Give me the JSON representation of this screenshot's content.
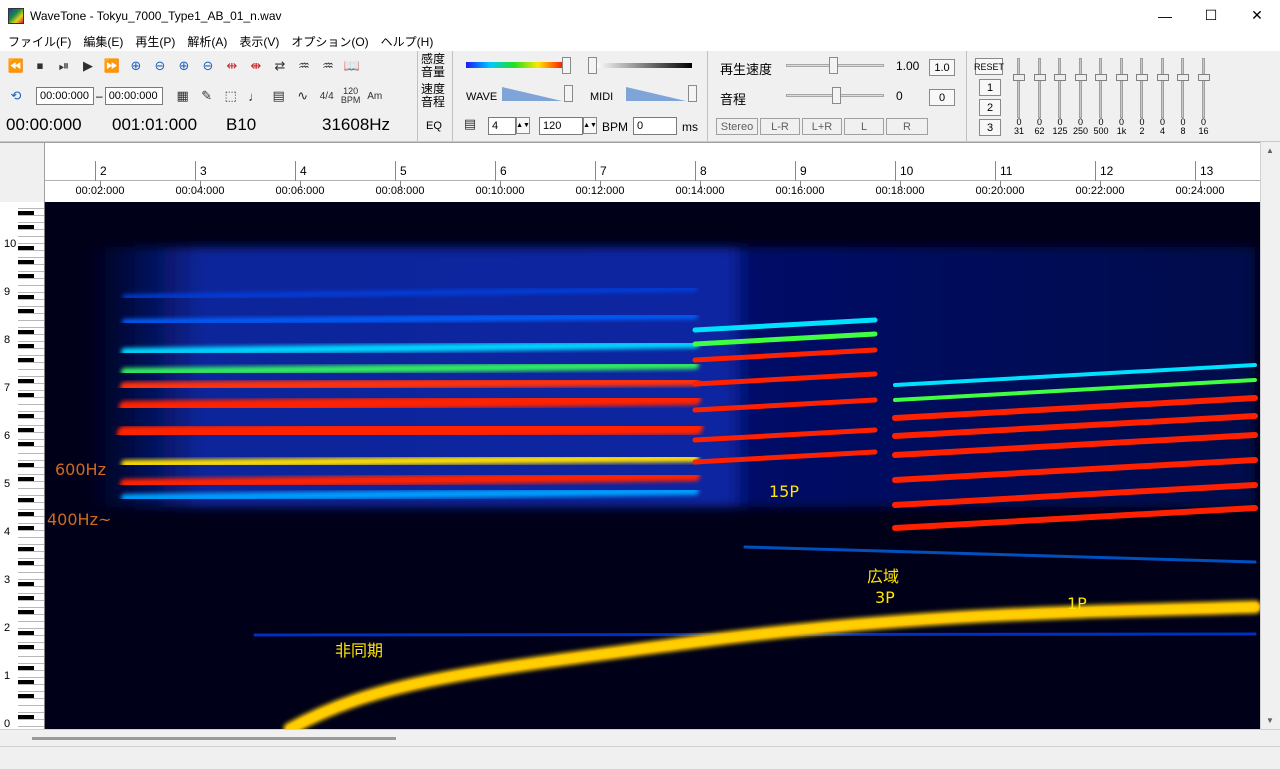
{
  "window": {
    "title": "WaveTone - Tokyu_7000_Type1_AB_01_n.wav",
    "minimize": "—",
    "maximize": "☐",
    "close": "✕"
  },
  "menu": [
    "ファイル(F)",
    "編集(E)",
    "再生(P)",
    "解析(A)",
    "表示(V)",
    "オプション(O)",
    "ヘルプ(H)"
  ],
  "transport": {
    "range_start": "00:00:000",
    "range_sep": "–",
    "range_end": "00:00:000",
    "meter": "4/4",
    "bpm_num": "120",
    "bpm_label": "BPM",
    "chord_label": "Am"
  },
  "status": {
    "position": "00:00:000",
    "measure": "001:01:000",
    "note": "B10",
    "frequency": "31608Hz"
  },
  "panel": {
    "sensitivity_label1": "感度",
    "sensitivity_label2": "音量",
    "speed_label1": "速度",
    "speed_label2": "音程",
    "wave_label": "WAVE",
    "midi_label": "MIDI",
    "eq_label": "EQ",
    "beat_value": "4",
    "bpm_value": "120",
    "bpm_unit": "BPM",
    "ms_value": "0",
    "ms_unit": "ms",
    "playback_speed_label": "再生速度",
    "playback_speed_value": "1.00",
    "playback_speed_reset": "1.0",
    "pitch_label": "音程",
    "pitch_value": "0",
    "pitch_reset": "0",
    "stereo_label": "Stereo",
    "channels": [
      "L-R",
      "L+R",
      "L",
      "R"
    ]
  },
  "equalizer": {
    "reset": "RESET",
    "presets": [
      "1",
      "2",
      "3"
    ],
    "bands": [
      {
        "value": "0",
        "freq": "31"
      },
      {
        "value": "0",
        "freq": "62"
      },
      {
        "value": "0",
        "freq": "125"
      },
      {
        "value": "0",
        "freq": "250"
      },
      {
        "value": "0",
        "freq": "500"
      },
      {
        "value": "0",
        "freq": "1k"
      },
      {
        "value": "0",
        "freq": "2"
      },
      {
        "value": "0",
        "freq": "4"
      },
      {
        "value": "0",
        "freq": "8"
      },
      {
        "value": "0",
        "freq": "16"
      }
    ]
  },
  "ruler": {
    "bars": [
      "2",
      "3",
      "4",
      "5",
      "6",
      "7",
      "8",
      "9",
      "10",
      "11",
      "12",
      "13"
    ],
    "times": [
      "00:02:000",
      "00:04:000",
      "00:06:000",
      "00:08:000",
      "00:10:000",
      "00:12:000",
      "00:14:000",
      "00:16:000",
      "00:18:000",
      "00:20:000",
      "00:22:000",
      "00:24:000"
    ]
  },
  "piano_octaves": [
    "10",
    "9",
    "8",
    "7",
    "6",
    "5",
    "4",
    "3",
    "2",
    "1",
    "0"
  ],
  "annotations": {
    "hz600": "600Hz",
    "hz400": "400Hz~",
    "p15": "15P",
    "wide1": "広域",
    "wide2": "3P",
    "p1": "1P",
    "async": "非同期"
  },
  "colors": {
    "annotation_orange": "#d06a1e",
    "annotation_yellow": "#ffe600"
  }
}
